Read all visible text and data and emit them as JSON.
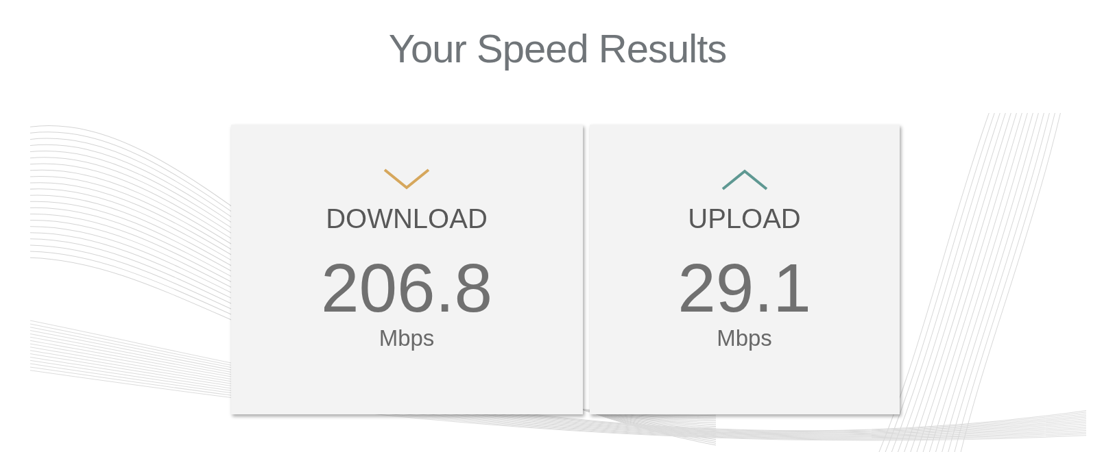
{
  "title": "Your Speed Results",
  "results": [
    {
      "kind": "download",
      "label": "DOWNLOAD",
      "value": "206.8",
      "unit": "Mbps"
    },
    {
      "kind": "upload",
      "label": "UPLOAD",
      "value": "29.1",
      "unit": "Mbps"
    }
  ]
}
